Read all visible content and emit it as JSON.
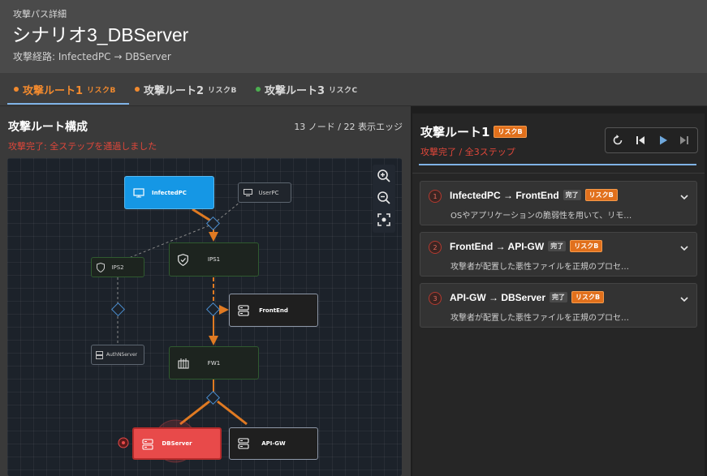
{
  "header": {
    "eyebrow": "攻撃パス詳細",
    "title": "シナリオ3_DBServer",
    "route": "攻撃経路: InfectedPC → DBServer"
  },
  "tabs": [
    {
      "label": "攻撃ルート1",
      "risk": "リスクB",
      "dot_color": "#f28a2e",
      "active": true
    },
    {
      "label": "攻撃ルート2",
      "risk": "リスクB",
      "dot_color": "#f28a2e",
      "active": false
    },
    {
      "label": "攻撃ルート3",
      "risk": "リスクC",
      "dot_color": "#4caf50",
      "active": false
    }
  ],
  "left": {
    "section_title": "攻撃ルート構成",
    "counts": "13 ノード / 22 表示エッジ",
    "status": "攻撃完了: 全ステップを通過しました"
  },
  "graph": {
    "nodes": {
      "infected_pc": "InfectedPC",
      "user_pc": "UserPC",
      "ips2": "IPS2",
      "ips1": "IPS1",
      "front_end": "FrontEnd",
      "authn_server": "AuthNServer",
      "fw1": "FW1",
      "db_server": "DBServer",
      "api_gw": "API-GW"
    },
    "colors": {
      "attack_edge": "#e07a22",
      "infected": "#1597e5",
      "target": "#e84a4a",
      "firewall_border": "#2f5a2f"
    }
  },
  "right": {
    "title": "攻撃ルート1",
    "badge": "リスクB",
    "status": "攻撃完了 / 全3ステップ",
    "steps": [
      {
        "num": "1",
        "title": "InfectedPC → FrontEnd",
        "done": "完了",
        "risk": "リスクB",
        "desc": "OSやアプリケーションの脆弱性を用いて、リモ…"
      },
      {
        "num": "2",
        "title": "FrontEnd → API-GW",
        "done": "完了",
        "risk": "リスクB",
        "desc": "攻撃者が配置した悪性ファイルを正規のプロセ…"
      },
      {
        "num": "3",
        "title": "API-GW → DBServer",
        "done": "完了",
        "risk": "リスクB",
        "desc": "攻撃者が配置した悪性ファイルを正規のプロセ…"
      }
    ]
  }
}
